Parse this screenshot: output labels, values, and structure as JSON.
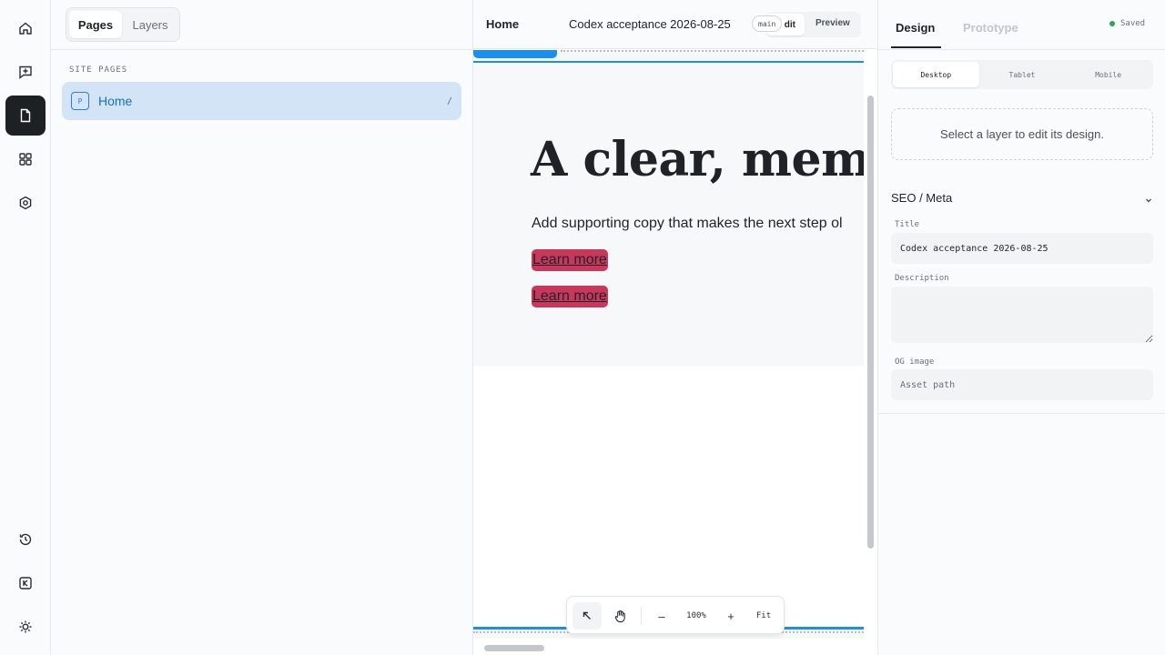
{
  "rail": {
    "items": [
      {
        "icon": "home-icon",
        "active": false
      },
      {
        "icon": "comment-plus-icon",
        "active": false
      },
      {
        "icon": "page-icon",
        "active": true
      },
      {
        "icon": "components-icon",
        "active": false
      },
      {
        "icon": "settings-hex-icon",
        "active": false
      }
    ],
    "bottom": [
      {
        "icon": "history-icon"
      },
      {
        "icon": "shortcut-k-icon"
      },
      {
        "icon": "theme-sun-icon"
      }
    ]
  },
  "pages_panel": {
    "tabs": [
      {
        "label": "Pages",
        "active": true
      },
      {
        "label": "Layers",
        "active": false
      }
    ],
    "section_label": "SITE PAGES",
    "pages": [
      {
        "badge": "P",
        "name": "Home",
        "path": "/"
      }
    ]
  },
  "canvas": {
    "topbar": {
      "page": "Home",
      "doc_title": "Codex acceptance 2026-08-25",
      "branch": "main",
      "edit_label": "dit",
      "preview_label": "Preview"
    },
    "hero": {
      "heading": "A clear, memo",
      "copy": "Add supporting copy that makes the next step ol",
      "cta_1": "Learn more",
      "cta_2": "Learn more"
    },
    "zoom": {
      "level": "100%",
      "minus": "–",
      "plus": "+",
      "fit": "Fit"
    }
  },
  "right_panel": {
    "tabs": [
      {
        "label": "Design",
        "active": true
      },
      {
        "label": "Prototype",
        "active": false
      }
    ],
    "status": "Saved",
    "status_color": "#2ea44f",
    "devices": [
      {
        "label": "Desktop",
        "active": true
      },
      {
        "label": "Tablet",
        "active": false
      },
      {
        "label": "Mobile",
        "active": false
      }
    ],
    "empty_message": "Select a layer to edit its design.",
    "seo": {
      "header": "SEO / Meta",
      "title_label": "Title",
      "title_value": "Codex acceptance 2026-08-25",
      "description_label": "Description",
      "description_value": "",
      "og_label": "OG image",
      "og_placeholder": "Asset path"
    }
  },
  "colors": {
    "accent": "#1a8ff0",
    "cta": "#c8385c",
    "selected_row": "#d4e4f7"
  }
}
